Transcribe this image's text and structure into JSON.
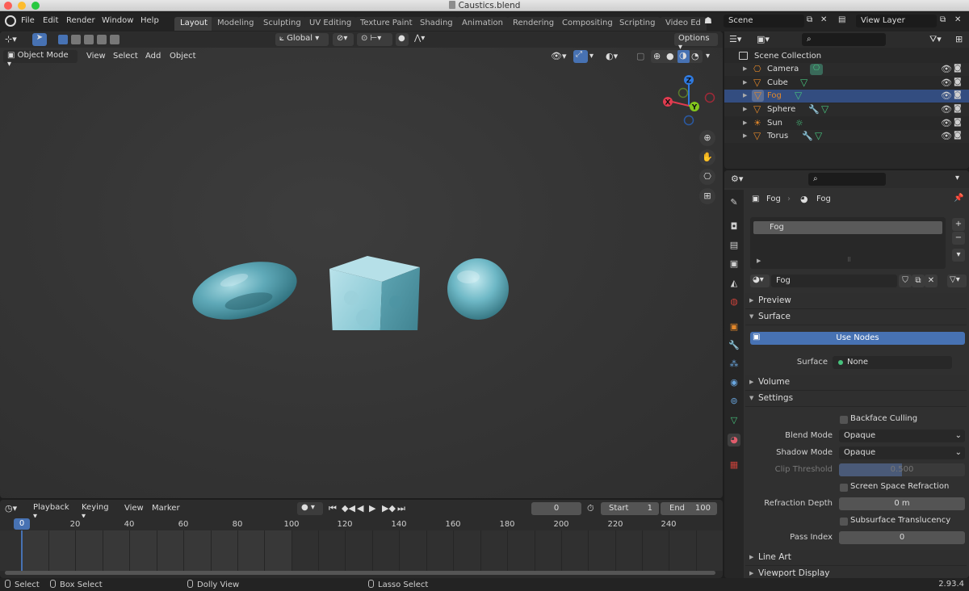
{
  "window": {
    "title": "Caustics.blend"
  },
  "menubar": {
    "items": [
      "File",
      "Edit",
      "Render",
      "Window",
      "Help"
    ]
  },
  "workspaces": {
    "tabs": [
      "Layout",
      "Modeling",
      "Sculpting",
      "UV Editing",
      "Texture Paint",
      "Shading",
      "Animation",
      "Rendering",
      "Compositing",
      "Scripting",
      "Video Ed"
    ],
    "active": "Layout"
  },
  "scene": {
    "name": "Scene"
  },
  "view_layer": {
    "name": "View Layer"
  },
  "viewport": {
    "transform_orientation": "Global",
    "options_label": "Options",
    "mode": "Object Mode",
    "menus": [
      "View",
      "Select",
      "Add",
      "Object"
    ],
    "gizmo": {
      "x": "X",
      "y": "Y",
      "z": "Z"
    }
  },
  "outliner": {
    "collection": "Scene Collection",
    "items": [
      {
        "name": "Camera",
        "selected": false
      },
      {
        "name": "Cube",
        "selected": false
      },
      {
        "name": "Fog",
        "selected": true
      },
      {
        "name": "Sphere",
        "selected": false
      },
      {
        "name": "Sun",
        "selected": false
      },
      {
        "name": "Torus",
        "selected": false
      }
    ]
  },
  "properties": {
    "breadcrumb_object": "Fog",
    "breadcrumb_material": "Fog",
    "slot_name": "Fog",
    "material_name": "Fog",
    "panels": {
      "preview": "Preview",
      "surface": "Surface",
      "volume": "Volume",
      "settings": "Settings",
      "line_art": "Line Art",
      "viewport_display": "Viewport Display"
    },
    "use_nodes_label": "Use Nodes",
    "surface_label": "Surface",
    "surface_value": "None",
    "backface_culling": "Backface Culling",
    "blend_mode_label": "Blend Mode",
    "blend_mode_value": "Opaque",
    "shadow_mode_label": "Shadow Mode",
    "shadow_mode_value": "Opaque",
    "clip_threshold_label": "Clip Threshold",
    "clip_threshold_value": "0.500",
    "clip_threshold_fraction": 0.5,
    "screen_space_refraction": "Screen Space Refraction",
    "refraction_depth_label": "Refraction Depth",
    "refraction_depth_value": "0 m",
    "subsurface_translucency": "Subsurface Translucency",
    "pass_index_label": "Pass Index",
    "pass_index_value": "0"
  },
  "timeline": {
    "menus": [
      "Playback",
      "Keying",
      "View",
      "Marker"
    ],
    "current_frame": "0",
    "start_label": "Start",
    "start_value": "1",
    "end_label": "End",
    "end_value": "100",
    "playhead_label": "0",
    "ticks": [
      "20",
      "40",
      "60",
      "80",
      "100",
      "120",
      "140",
      "160",
      "180",
      "200",
      "220",
      "240"
    ]
  },
  "statusbar": {
    "select": "Select",
    "box_select": "Box Select",
    "dolly_view": "Dolly View",
    "lasso_select": "Lasso Select",
    "version": "2.93.4"
  },
  "colors": {
    "accent": "#4772b3",
    "selection": "#334d80",
    "axis_x": "#e13b4f",
    "axis_y": "#83c81d",
    "axis_z": "#2f7ae0",
    "object_orange": "#e2872a",
    "data_green": "#47c27d",
    "material_surface": "#7fc3d0"
  }
}
